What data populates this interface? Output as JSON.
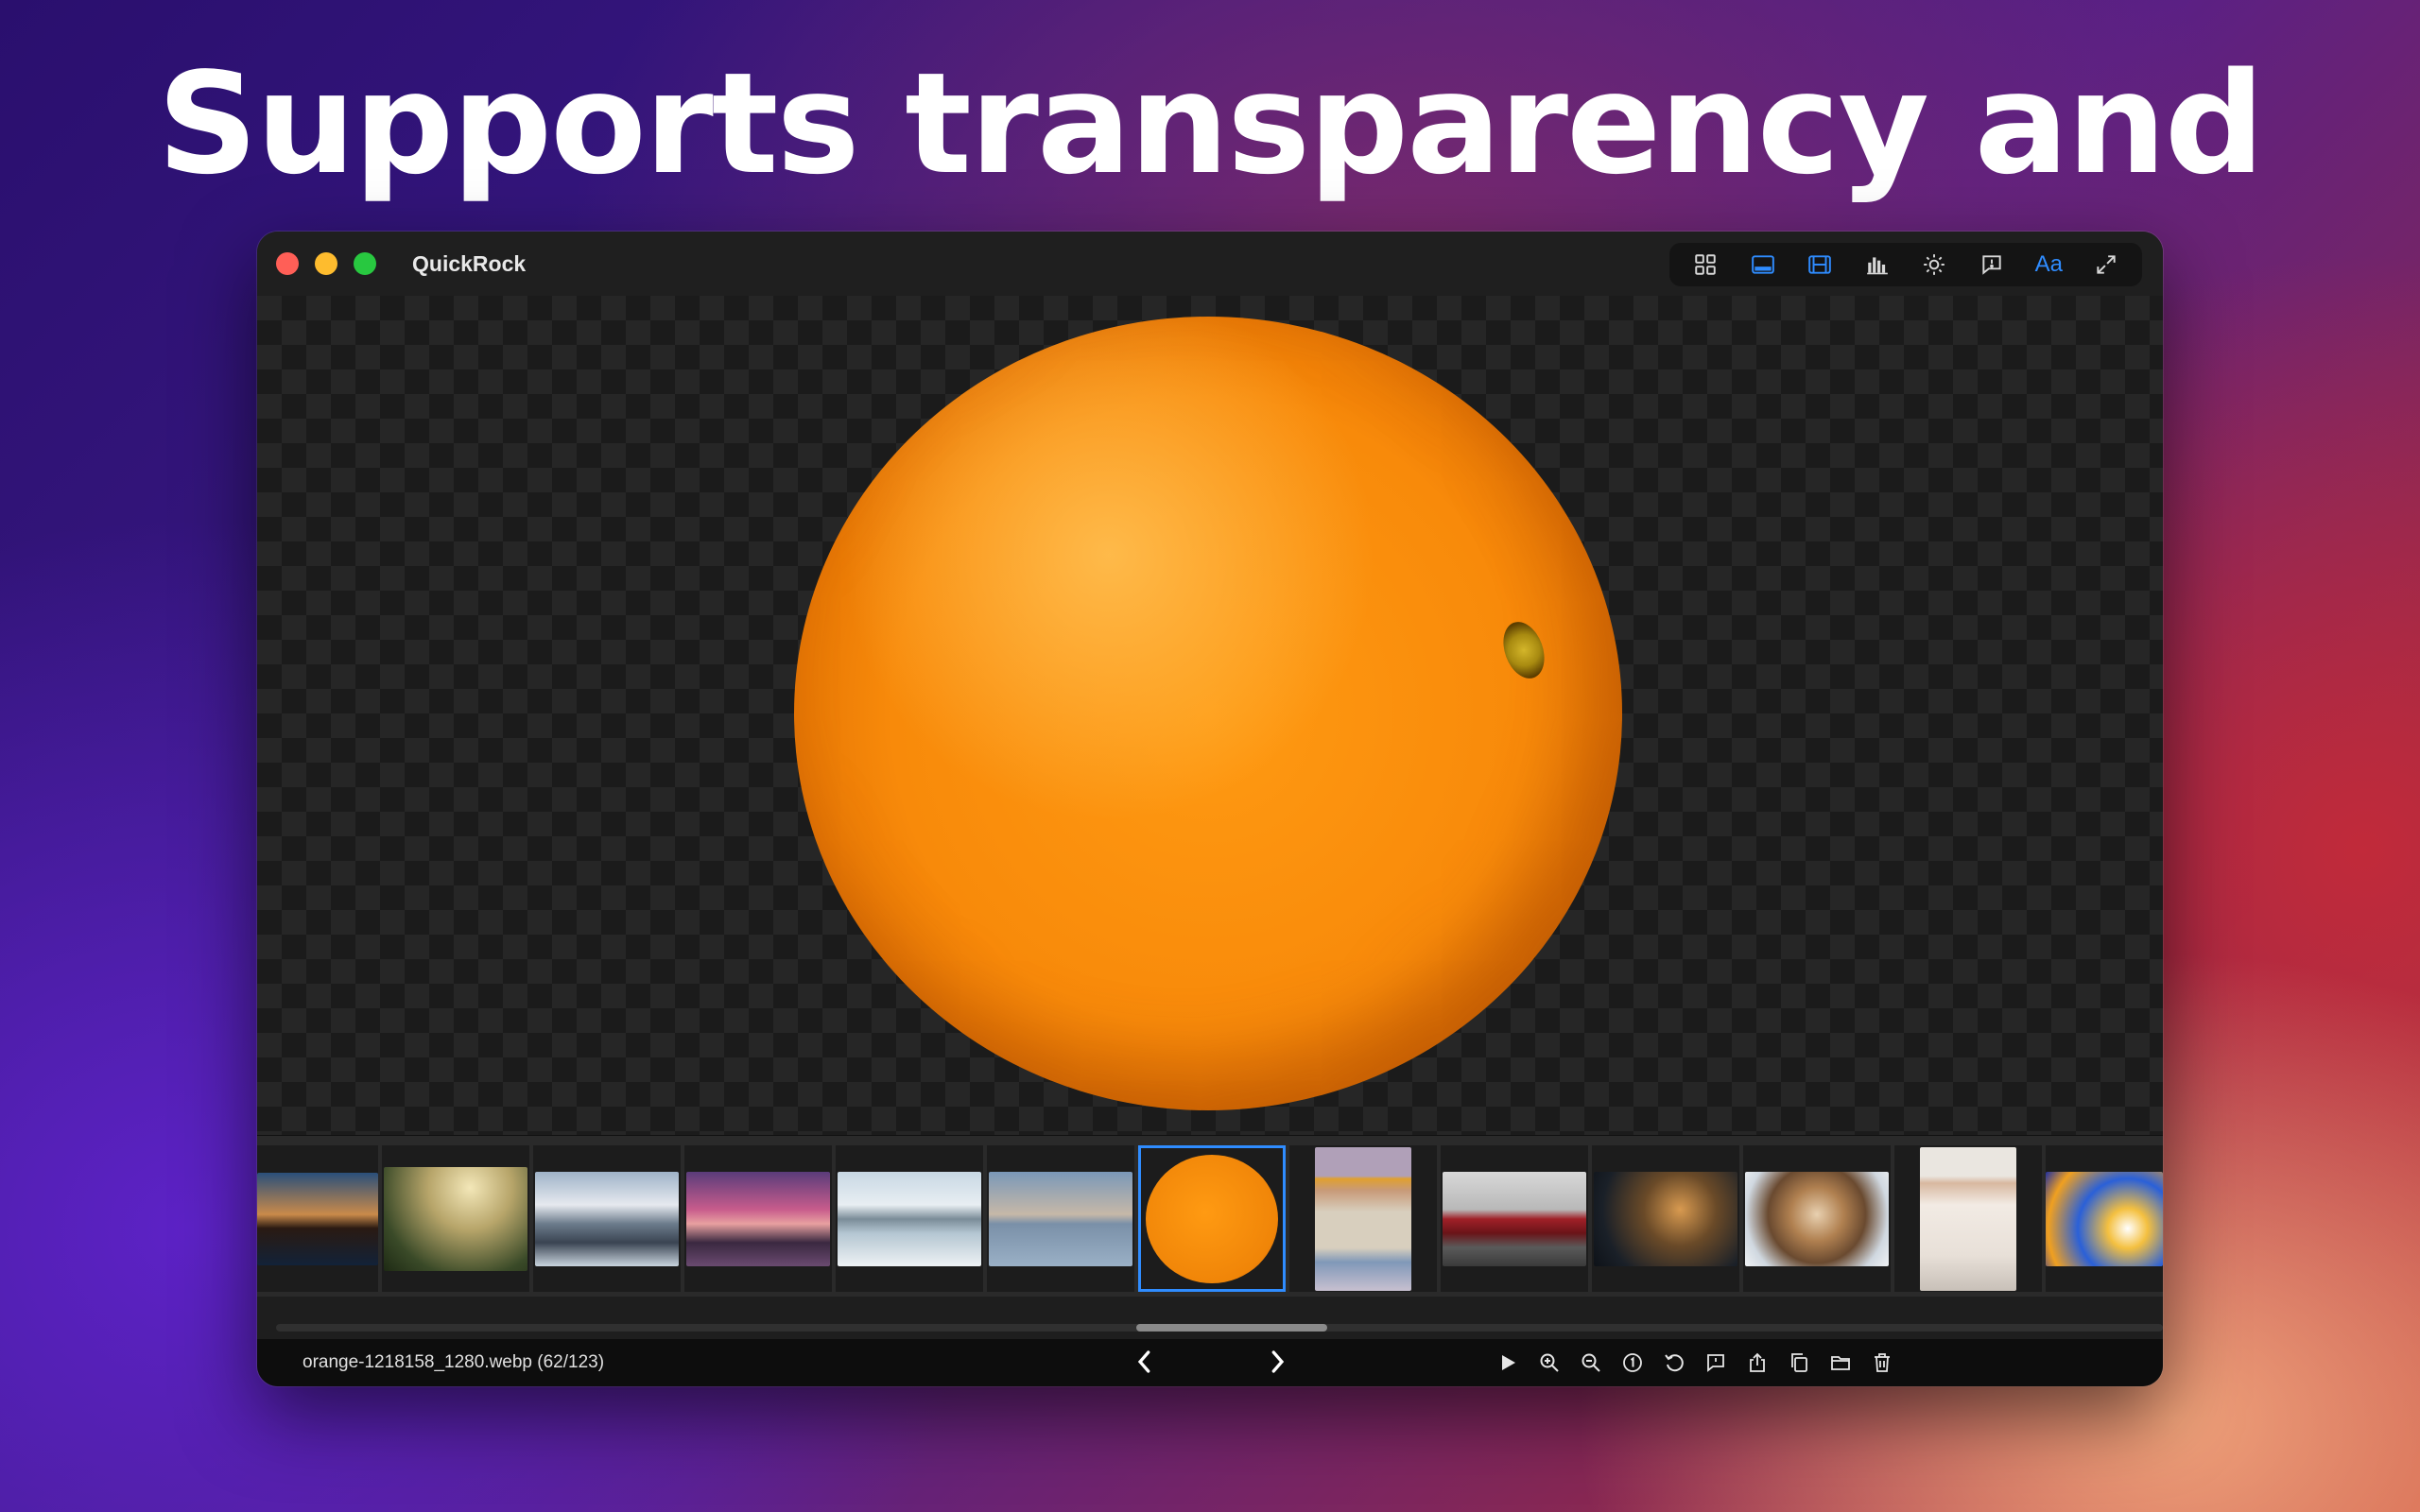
{
  "headline": "Supports transparency and EXR",
  "window": {
    "app_title": "QuickRock",
    "traffic_lights": {
      "close": "#ff5f57",
      "minimize": "#febc2e",
      "maximize": "#28c840"
    }
  },
  "toolbar": {
    "buttons": [
      {
        "icon": "grid-icon",
        "active": false
      },
      {
        "icon": "bottom-panel-icon",
        "active": true
      },
      {
        "icon": "filmstrip-icon",
        "active": true
      },
      {
        "icon": "histogram-icon",
        "active": false
      },
      {
        "icon": "brightness-icon",
        "active": false
      },
      {
        "icon": "info-bubble-icon",
        "active": false
      },
      {
        "icon": "text-label-icon",
        "label": "Aa",
        "active": true
      },
      {
        "icon": "fullscreen-icon",
        "active": false
      }
    ],
    "accent_color": "#2f8cff"
  },
  "viewer": {
    "image": "orange",
    "background": "transparency-checkerboard"
  },
  "filmstrip": {
    "thumbnails": [
      {
        "subject": "city-lake-sunset",
        "selected": false
      },
      {
        "subject": "misty-forest",
        "selected": false
      },
      {
        "subject": "snowy-mountains",
        "selected": false
      },
      {
        "subject": "pier-sunset",
        "selected": false
      },
      {
        "subject": "mountain-lake-mist",
        "selected": false
      },
      {
        "subject": "sailboat-calm-sea",
        "selected": false
      },
      {
        "subject": "orange",
        "selected": true
      },
      {
        "subject": "man-yellow-beanie",
        "selected": false
      },
      {
        "subject": "red-car",
        "selected": false
      },
      {
        "subject": "city-night-lights",
        "selected": false
      },
      {
        "subject": "dog-closeup",
        "selected": false
      },
      {
        "subject": "woman-white-room",
        "selected": false
      },
      {
        "subject": "colorful-fractal",
        "selected": false
      }
    ]
  },
  "statusbar": {
    "filename": "orange-1218158_1280.webp (62/123)",
    "prev_glyph": "‹",
    "next_glyph": "›",
    "actions": [
      "play-icon",
      "zoom-in-icon",
      "zoom-out-icon",
      "actual-size-icon",
      "rotate-icon",
      "comment-icon",
      "share-icon",
      "copy-icon",
      "folder-icon",
      "trash-icon"
    ]
  }
}
